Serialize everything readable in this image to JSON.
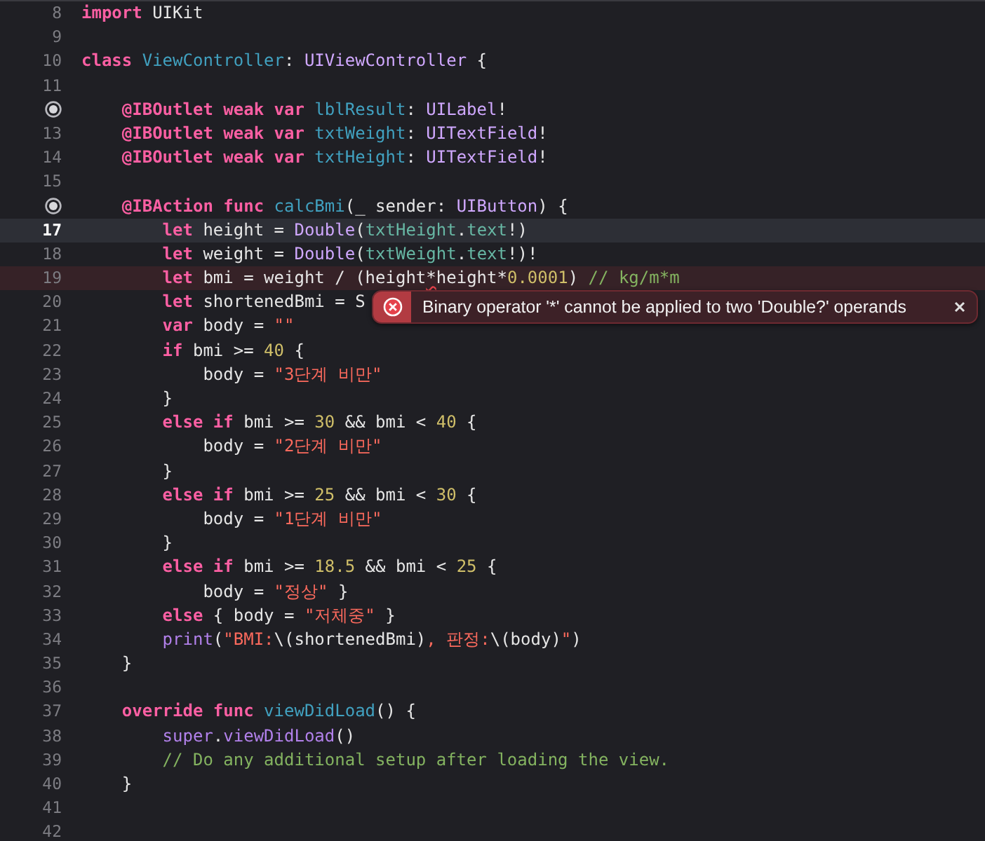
{
  "editor": {
    "lines": [
      {
        "number": "8",
        "outlet": false,
        "current": false,
        "error": false,
        "tokens": [
          {
            "kind": "keyword",
            "text": "import"
          },
          {
            "kind": "plain",
            "text": " UIKit"
          }
        ]
      },
      {
        "number": "9",
        "outlet": false,
        "current": false,
        "error": false
      },
      {
        "number": "10",
        "outlet": false,
        "current": false,
        "error": false,
        "tokens": [
          {
            "kind": "keyword",
            "text": "class"
          },
          {
            "kind": "declaration",
            "text": " ViewController"
          },
          {
            "kind": "plain",
            "text": ": "
          },
          {
            "kind": "type",
            "text": "UIViewController"
          },
          {
            "kind": "plain",
            "text": " {"
          }
        ]
      },
      {
        "number": "11",
        "outlet": false,
        "current": false,
        "error": false
      },
      {
        "outlet": true,
        "current": false,
        "error": false,
        "tokens": [
          {
            "kind": "keyword",
            "text": "    @IBOutlet weak var"
          },
          {
            "kind": "declaration",
            "text": " lblResult"
          },
          {
            "kind": "plain",
            "text": ": "
          },
          {
            "kind": "type",
            "text": "UILabel"
          },
          {
            "kind": "plain",
            "text": "!"
          }
        ]
      },
      {
        "number": "13",
        "outlet": false,
        "current": false,
        "error": false,
        "tokens": [
          {
            "kind": "keyword",
            "text": "    @IBOutlet weak var"
          },
          {
            "kind": "declaration",
            "text": " txtWeight"
          },
          {
            "kind": "plain",
            "text": ": "
          },
          {
            "kind": "type",
            "text": "UITextField"
          },
          {
            "kind": "plain",
            "text": "!"
          }
        ]
      },
      {
        "number": "14",
        "outlet": false,
        "current": false,
        "error": false,
        "tokens": [
          {
            "kind": "keyword",
            "text": "    @IBOutlet weak var"
          },
          {
            "kind": "declaration",
            "text": " txtHeight"
          },
          {
            "kind": "plain",
            "text": ": "
          },
          {
            "kind": "type",
            "text": "UITextField"
          },
          {
            "kind": "plain",
            "text": "!"
          }
        ]
      },
      {
        "number": "15",
        "outlet": false,
        "current": false,
        "error": false
      },
      {
        "outlet": true,
        "current": false,
        "error": false,
        "tokens": [
          {
            "kind": "keyword",
            "text": "    @IBAction func"
          },
          {
            "kind": "declaration",
            "text": " calcBmi"
          },
          {
            "kind": "plain",
            "text": "(_ sender: "
          },
          {
            "kind": "type",
            "text": "UIButton"
          },
          {
            "kind": "plain",
            "text": ") {"
          }
        ]
      },
      {
        "number": "17",
        "outlet": false,
        "current": true,
        "error": false,
        "tokens": [
          {
            "kind": "keyword",
            "text": "        let"
          },
          {
            "kind": "plain",
            "text": " height = "
          },
          {
            "kind": "type",
            "text": "Double"
          },
          {
            "kind": "plain",
            "text": "("
          },
          {
            "kind": "member",
            "text": "txtHeight"
          },
          {
            "kind": "plain",
            "text": "."
          },
          {
            "kind": "member",
            "text": "text"
          },
          {
            "kind": "plain",
            "text": "!)"
          }
        ]
      },
      {
        "number": "18",
        "outlet": false,
        "current": false,
        "error": false,
        "tokens": [
          {
            "kind": "keyword",
            "text": "        let"
          },
          {
            "kind": "plain",
            "text": " weight = "
          },
          {
            "kind": "type",
            "text": "Double"
          },
          {
            "kind": "plain",
            "text": "("
          },
          {
            "kind": "member",
            "text": "txtWeight"
          },
          {
            "kind": "plain",
            "text": "."
          },
          {
            "kind": "member",
            "text": "text"
          },
          {
            "kind": "plain",
            "text": "!)!"
          }
        ]
      },
      {
        "number": "19",
        "outlet": false,
        "current": false,
        "error": true,
        "issue": {
          "kind": "error",
          "message": "Binary operator '*' cannot be applied to two 'Double?' operands"
        },
        "tokens": [
          {
            "kind": "keyword",
            "text": "        let"
          },
          {
            "kind": "plain",
            "text": " bmi = weight / (height"
          },
          {
            "kind": "error_operator",
            "text": "*"
          },
          {
            "kind": "plain",
            "text": "height*"
          },
          {
            "kind": "number",
            "text": "0.0001"
          },
          {
            "kind": "plain",
            "text": ")"
          },
          {
            "kind": "comment",
            "text": " // kg/m*m"
          }
        ]
      },
      {
        "number": "20",
        "outlet": false,
        "current": false,
        "error": false,
        "tokens": [
          {
            "kind": "keyword",
            "text": "        let"
          },
          {
            "kind": "plain",
            "text": " shortenedBmi = S"
          }
        ]
      },
      {
        "number": "21",
        "outlet": false,
        "current": false,
        "error": false,
        "tokens": [
          {
            "kind": "keyword",
            "text": "        var"
          },
          {
            "kind": "plain",
            "text": " body = "
          },
          {
            "kind": "string",
            "text": "\"\""
          }
        ]
      },
      {
        "number": "22",
        "outlet": false,
        "current": false,
        "error": false,
        "tokens": [
          {
            "kind": "keyword",
            "text": "        if"
          },
          {
            "kind": "plain",
            "text": " bmi >= "
          },
          {
            "kind": "number",
            "text": "40"
          },
          {
            "kind": "plain",
            "text": " {"
          }
        ]
      },
      {
        "number": "23",
        "outlet": false,
        "current": false,
        "error": false,
        "tokens": [
          {
            "kind": "plain",
            "text": "            body = "
          },
          {
            "kind": "string",
            "text": "\"3단계 비만\""
          }
        ]
      },
      {
        "number": "24",
        "outlet": false,
        "current": false,
        "error": false,
        "tokens": [
          {
            "kind": "plain",
            "text": "        }"
          }
        ]
      },
      {
        "number": "25",
        "outlet": false,
        "current": false,
        "error": false,
        "tokens": [
          {
            "kind": "keyword",
            "text": "        else if"
          },
          {
            "kind": "plain",
            "text": " bmi >= "
          },
          {
            "kind": "number",
            "text": "30"
          },
          {
            "kind": "plain",
            "text": " && bmi < "
          },
          {
            "kind": "number",
            "text": "40"
          },
          {
            "kind": "plain",
            "text": " {"
          }
        ]
      },
      {
        "number": "26",
        "outlet": false,
        "current": false,
        "error": false,
        "tokens": [
          {
            "kind": "plain",
            "text": "            body = "
          },
          {
            "kind": "string",
            "text": "\"2단계 비만\""
          }
        ]
      },
      {
        "number": "27",
        "outlet": false,
        "current": false,
        "error": false,
        "tokens": [
          {
            "kind": "plain",
            "text": "        }"
          }
        ]
      },
      {
        "number": "28",
        "outlet": false,
        "current": false,
        "error": false,
        "tokens": [
          {
            "kind": "keyword",
            "text": "        else if"
          },
          {
            "kind": "plain",
            "text": " bmi >= "
          },
          {
            "kind": "number",
            "text": "25"
          },
          {
            "kind": "plain",
            "text": " && bmi < "
          },
          {
            "kind": "number",
            "text": "30"
          },
          {
            "kind": "plain",
            "text": " {"
          }
        ]
      },
      {
        "number": "29",
        "outlet": false,
        "current": false,
        "error": false,
        "tokens": [
          {
            "kind": "plain",
            "text": "            body = "
          },
          {
            "kind": "string",
            "text": "\"1단계 비만\""
          }
        ]
      },
      {
        "number": "30",
        "outlet": false,
        "current": false,
        "error": false,
        "tokens": [
          {
            "kind": "plain",
            "text": "        }"
          }
        ]
      },
      {
        "number": "31",
        "outlet": false,
        "current": false,
        "error": false,
        "tokens": [
          {
            "kind": "keyword",
            "text": "        else if"
          },
          {
            "kind": "plain",
            "text": " bmi >= "
          },
          {
            "kind": "number",
            "text": "18.5"
          },
          {
            "kind": "plain",
            "text": " && bmi < "
          },
          {
            "kind": "number",
            "text": "25"
          },
          {
            "kind": "plain",
            "text": " {"
          }
        ]
      },
      {
        "number": "32",
        "outlet": false,
        "current": false,
        "error": false,
        "tokens": [
          {
            "kind": "plain",
            "text": "            body = "
          },
          {
            "kind": "string",
            "text": "\"정상\""
          },
          {
            "kind": "plain",
            "text": " }"
          }
        ]
      },
      {
        "number": "33",
        "outlet": false,
        "current": false,
        "error": false,
        "tokens": [
          {
            "kind": "keyword",
            "text": "        else"
          },
          {
            "kind": "plain",
            "text": " { body = "
          },
          {
            "kind": "string",
            "text": "\"저체중\""
          },
          {
            "kind": "plain",
            "text": " }"
          }
        ]
      },
      {
        "number": "34",
        "outlet": false,
        "current": false,
        "error": false,
        "tokens": [
          {
            "kind": "call",
            "text": "        print"
          },
          {
            "kind": "plain",
            "text": "("
          },
          {
            "kind": "string",
            "text": "\"BMI:"
          },
          {
            "kind": "plain",
            "text": "\\(shortenedBmi)"
          },
          {
            "kind": "string",
            "text": ", 판정:"
          },
          {
            "kind": "plain",
            "text": "\\(body)"
          },
          {
            "kind": "string",
            "text": "\""
          },
          {
            "kind": "plain",
            "text": ")"
          }
        ]
      },
      {
        "number": "35",
        "outlet": false,
        "current": false,
        "error": false,
        "tokens": [
          {
            "kind": "plain",
            "text": "    }"
          }
        ]
      },
      {
        "number": "36",
        "outlet": false,
        "current": false,
        "error": false
      },
      {
        "number": "37",
        "outlet": false,
        "current": false,
        "error": false,
        "tokens": [
          {
            "kind": "keyword",
            "text": "    override func"
          },
          {
            "kind": "declaration",
            "text": " viewDidLoad"
          },
          {
            "kind": "plain",
            "text": "() {"
          }
        ]
      },
      {
        "number": "38",
        "outlet": false,
        "current": false,
        "error": false,
        "tokens": [
          {
            "kind": "call",
            "text": "        super"
          },
          {
            "kind": "plain",
            "text": "."
          },
          {
            "kind": "call",
            "text": "viewDidLoad"
          },
          {
            "kind": "plain",
            "text": "()"
          }
        ]
      },
      {
        "number": "39",
        "outlet": false,
        "current": false,
        "error": false,
        "tokens": [
          {
            "kind": "comment",
            "text": "        // Do any additional setup after loading the view."
          }
        ]
      },
      {
        "number": "40",
        "outlet": false,
        "current": false,
        "error": false,
        "tokens": [
          {
            "kind": "plain",
            "text": "    }"
          }
        ]
      },
      {
        "number": "41",
        "outlet": false,
        "current": false,
        "error": false
      },
      {
        "number": "42",
        "outlet": false,
        "current": false,
        "error": false
      }
    ]
  }
}
